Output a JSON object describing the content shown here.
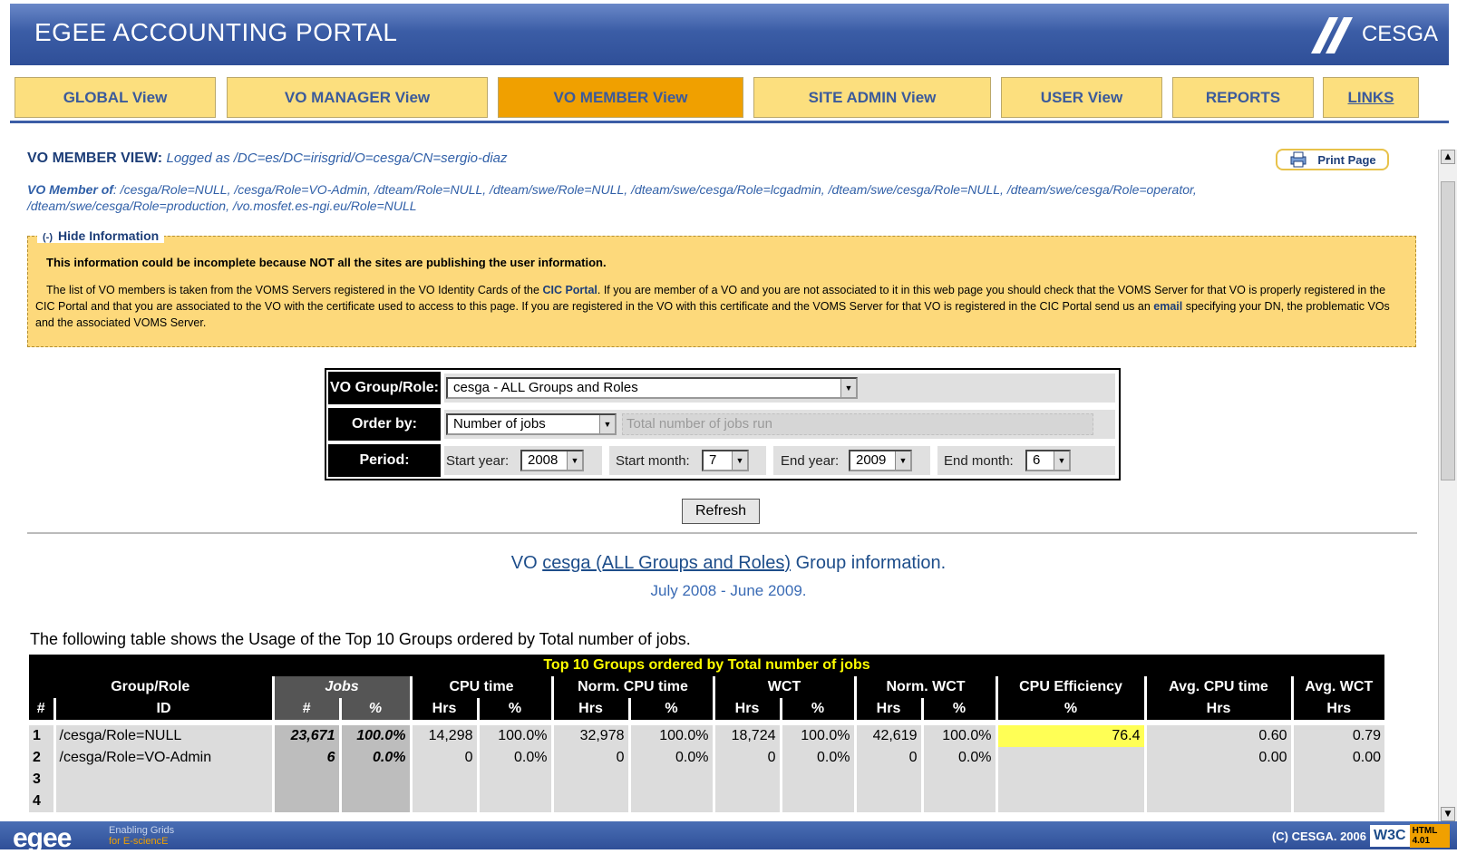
{
  "header": {
    "title": "EGEE ACCOUNTING PORTAL",
    "logo_text": "CESGA"
  },
  "tabs": [
    {
      "label": "GLOBAL View"
    },
    {
      "label": "VO MANAGER View"
    },
    {
      "label": "VO MEMBER View"
    },
    {
      "label": "SITE ADMIN View"
    },
    {
      "label": "USER View"
    },
    {
      "label": "REPORTS"
    },
    {
      "label": "LINKS"
    }
  ],
  "active_tab": "VO MEMBER View",
  "view": {
    "title": "VO MEMBER VIEW:",
    "logged_as": "Logged as /DC=es/DC=irisgrid/O=cesga/CN=sergio-diaz",
    "print_label": "Print Page",
    "member_of_label": "VO Member of",
    "member_of_value": ": /cesga/Role=NULL, /cesga/Role=VO-Admin, /dteam/Role=NULL, /dteam/swe/Role=NULL, /dteam/swe/cesga/Role=lcgadmin, /dteam/swe/cesga/Role=NULL, /dteam/swe/cesga/Role=operator, /dteam/swe/cesga/Role=production, /vo.mosfet.es-ngi.eu/Role=NULL"
  },
  "info": {
    "toggle": "(-)",
    "legend": "Hide Information",
    "warning": "This information could be incomplete because NOT all the sites are publishing the user information.",
    "text_1": "The list of VO members is taken from the VOMS Servers registered in the VO Identity Cards of the ",
    "link_cic": "CIC Portal",
    "text_2": ". If you are member of a VO and you are not associated to it in this web page you should check that the VOMS Server for that VO is properly registered in the CIC Portal and that you are associated to the VO with the certificate used to access to this page. If you are registered in the VO with this certificate and the VOMS Server for that VO is registered in the CIC Portal send us an ",
    "link_email": "email",
    "text_3": " specifying your DN, the problematic VOs and the associated VOMS Server."
  },
  "form": {
    "vo_label": "VO Group/Role:",
    "vo_value": "cesga - ALL Groups and Roles",
    "order_label": "Order by:",
    "order_value": "Number of jobs",
    "order_desc": "Total number of jobs run",
    "period_label": "Period:",
    "start_year_label": "Start year:",
    "start_year": "2008",
    "start_month_label": "Start month:",
    "start_month": "7",
    "end_year_label": "End year:",
    "end_year": "2009",
    "end_month_label": "End month:",
    "end_month": "6",
    "refresh_label": "Refresh"
  },
  "group_info": {
    "prefix": "VO ",
    "link": "cesga (ALL Groups and Roles)",
    "suffix": " Group information.",
    "period": "July 2008 - June 2009."
  },
  "table": {
    "description": "The following table shows the Usage of the Top 10 Groups ordered by Total number of jobs.",
    "caption": "Top 10 Groups ordered by Total number of jobs",
    "headers": [
      "Group/Role",
      "Jobs",
      "CPU time",
      "Norm. CPU time",
      "WCT",
      "Norm. WCT",
      "CPU Efficiency",
      "Avg. CPU time",
      "Avg. WCT"
    ],
    "subheaders": [
      "#",
      "ID",
      "#",
      "%",
      "Hrs",
      "%",
      "Hrs",
      "%",
      "Hrs",
      "%",
      "Hrs",
      "%",
      "%",
      "Hrs",
      "Hrs"
    ],
    "rows": [
      [
        "1",
        "/cesga/Role=NULL",
        "23,671",
        "100.0%",
        "14,298",
        "100.0%",
        "32,978",
        "100.0%",
        "18,724",
        "100.0%",
        "42,619",
        "100.0%",
        "76.4",
        "0.60",
        "0.79"
      ],
      [
        "2",
        "/cesga/Role=VO-Admin",
        "6",
        "0.0%",
        "0",
        "0.0%",
        "0",
        "0.0%",
        "0",
        "0.0%",
        "0",
        "0.0%",
        "",
        "0.00",
        "0.00"
      ],
      [
        "3",
        "",
        "",
        "",
        "",
        "",
        "",
        "",
        "",
        "",
        "",
        "",
        "",
        "",
        ""
      ],
      [
        "4",
        "",
        "",
        "",
        "",
        "",
        "",
        "",
        "",
        "",
        "",
        "",
        "",
        "",
        ""
      ]
    ]
  },
  "footer": {
    "logo": "egee",
    "slogan_1": "Enabling Grids",
    "slogan_2": "for E-sciencE",
    "copyright": "(C) CESGA. 2006",
    "w3c": "W3C",
    "html_badge": "HTML 4.01"
  }
}
